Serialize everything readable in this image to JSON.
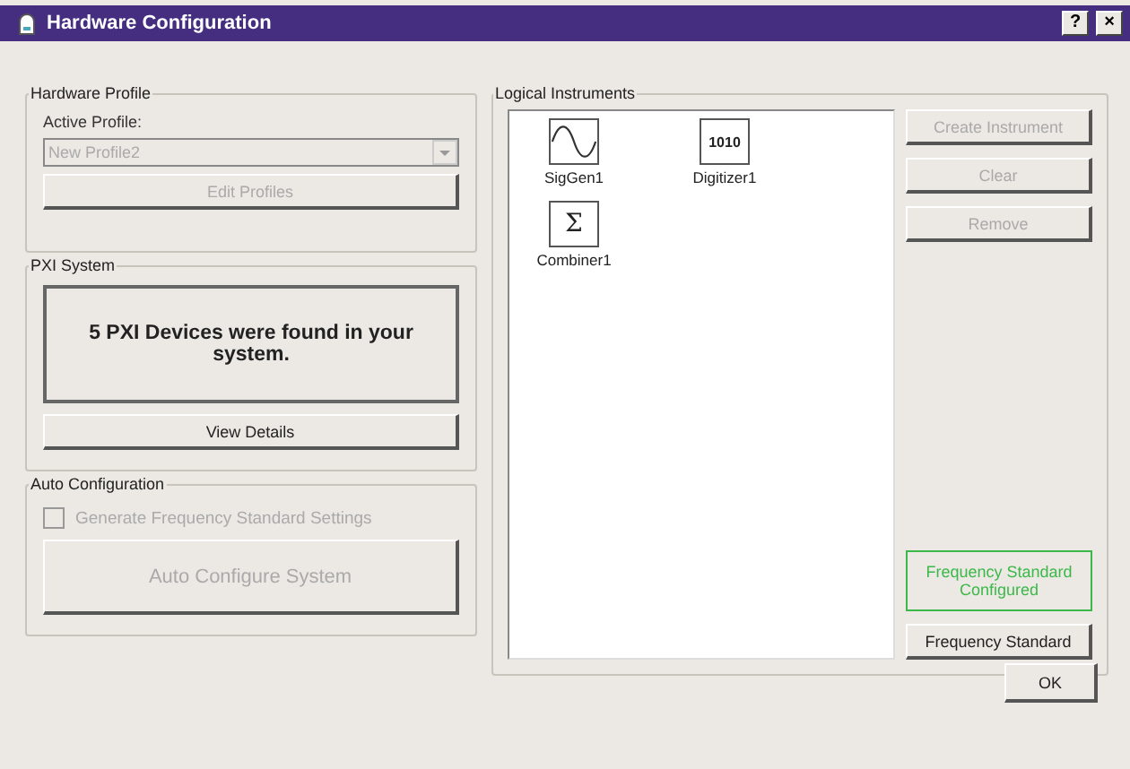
{
  "window": {
    "title": "Hardware Configuration",
    "help": "?",
    "close": "×"
  },
  "hardware_profile": {
    "title": "Hardware Profile",
    "label": "Active Profile:",
    "value": "New Profile2",
    "disabled": true,
    "edit_button": {
      "label": "Edit Profiles",
      "disabled": true
    }
  },
  "pxi_system": {
    "title": "PXI System",
    "message": "5 PXI Devices were found in your system.",
    "details_button": {
      "label": "View Details",
      "disabled": false
    }
  },
  "auto_configuration": {
    "title": "Auto Configuration",
    "checkbox": {
      "label": "Generate Frequency Standard Settings",
      "checked": false,
      "disabled": true
    },
    "configure_button": {
      "label": "Auto Configure System",
      "disabled": true
    }
  },
  "logical_instruments": {
    "title": "Logical Instruments",
    "items": [
      {
        "label": "SigGen1",
        "kind": "wave"
      },
      {
        "label": "Digitizer1",
        "kind": "digital",
        "glyph": "1010"
      },
      {
        "label": "Combiner1",
        "kind": "sum",
        "glyph": "Σ"
      }
    ],
    "buttons": [
      {
        "label": "Create Instrument",
        "disabled": true
      },
      {
        "label": "Clear",
        "disabled": true
      },
      {
        "label": "Remove",
        "disabled": true
      }
    ],
    "status": {
      "label": "Frequency Standard Configured",
      "color": "#3cb84a"
    },
    "frequency_button": {
      "label": "Frequency Standard",
      "disabled": false
    }
  },
  "ok_button": {
    "label": "OK"
  }
}
